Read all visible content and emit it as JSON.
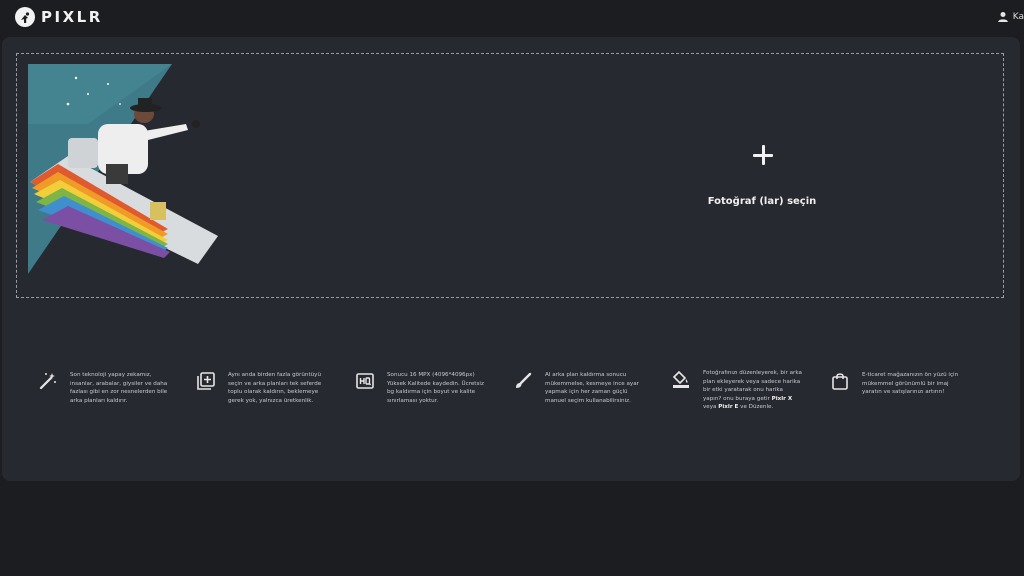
{
  "header": {
    "logo_text": "PIXLR",
    "user_label": "Ka"
  },
  "dropzone": {
    "select_label": "Fotoğraf (lar) seçin"
  },
  "features": [
    {
      "icon": "magic-wand-icon",
      "text": "Son teknoloji yapay zekamız, insanlar, arabalar, giysiler ve daha fazlası gibi en zor nesnelerden bile arka planları kaldırır."
    },
    {
      "icon": "batch-add-icon",
      "text": "Aynı anda birden fazla görüntüyü seçin ve arka planları tek seferde toplu olarak kaldırın, beklemeye gerek yok, yalnızca üretkenlik."
    },
    {
      "icon": "hq-icon",
      "text": "Sonucu 16 MPX (4096*4096px) Yüksek Kalitede kaydedin. Ücretsiz bg kaldırma için boyut ve kalite sınırlaması yoktur."
    },
    {
      "icon": "brush-icon",
      "text": "AI arka plan kaldırma sonucu mükemmelse, kesmeye ince ayar yapmak için her zaman güçlü manuel seçim kullanabilirsiniz."
    },
    {
      "icon": "paint-bucket-icon",
      "text_before": "Fotoğrafınızı düzenleyerek, bir arka plan ekleyerek veya sadece harika bir etki yaratarak onu harika yapın? onu buraya getir ",
      "link1": "Pixlr X",
      "text_mid": " veya ",
      "link2": "Pixlr E",
      "text_after": " ve Düzenle."
    },
    {
      "icon": "shopping-bag-icon",
      "text": "E-ticaret mağazanızın ön yüzü için mükemmel görünümlü bir imaj yaratın ve satışlarınızı artırın!"
    }
  ]
}
